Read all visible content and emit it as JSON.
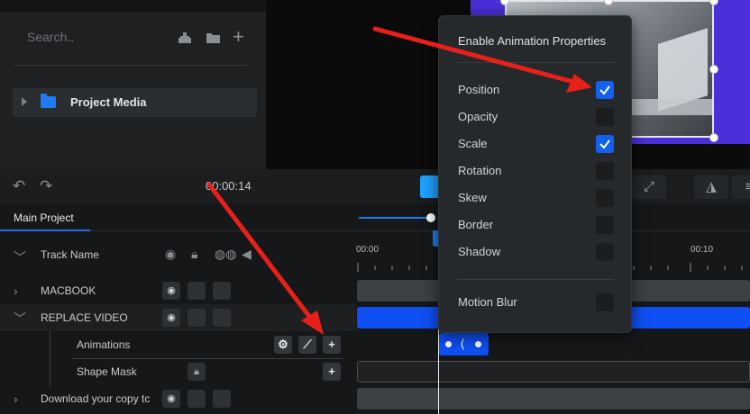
{
  "media": {
    "search_placeholder": "Search..",
    "folder_label": "Project Media",
    "icons": [
      "import-icon",
      "folder-icon",
      "plus-icon"
    ]
  },
  "transport": {
    "timecode": "00:00:14",
    "undo_icon": "undo-icon",
    "redo_icon": "redo-icon"
  },
  "tabs": {
    "main": "Main Project"
  },
  "timeline": {
    "header_name": "Track Name",
    "time_labels": [
      "00:00",
      "00:10"
    ],
    "tracks": [
      {
        "name": "MACBOOK"
      },
      {
        "name": "REPLACE VIDEO"
      },
      {
        "name": "Animations"
      },
      {
        "name": "Shape Mask"
      },
      {
        "name": "Download your copy tc"
      }
    ]
  },
  "popup": {
    "title": "Enable Animation Properties",
    "properties": [
      {
        "label": "Position",
        "checked": true
      },
      {
        "label": "Opacity",
        "checked": false
      },
      {
        "label": "Scale",
        "checked": true
      },
      {
        "label": "Rotation",
        "checked": false
      },
      {
        "label": "Skew",
        "checked": false
      },
      {
        "label": "Border",
        "checked": false
      },
      {
        "label": "Shadow",
        "checked": false
      }
    ],
    "motion_blur": {
      "label": "Motion Blur",
      "checked": false
    }
  },
  "colors": {
    "accent": "#1160f0",
    "clip_blue": "#0f50f5",
    "annotation_arrow": "#e8201a"
  }
}
